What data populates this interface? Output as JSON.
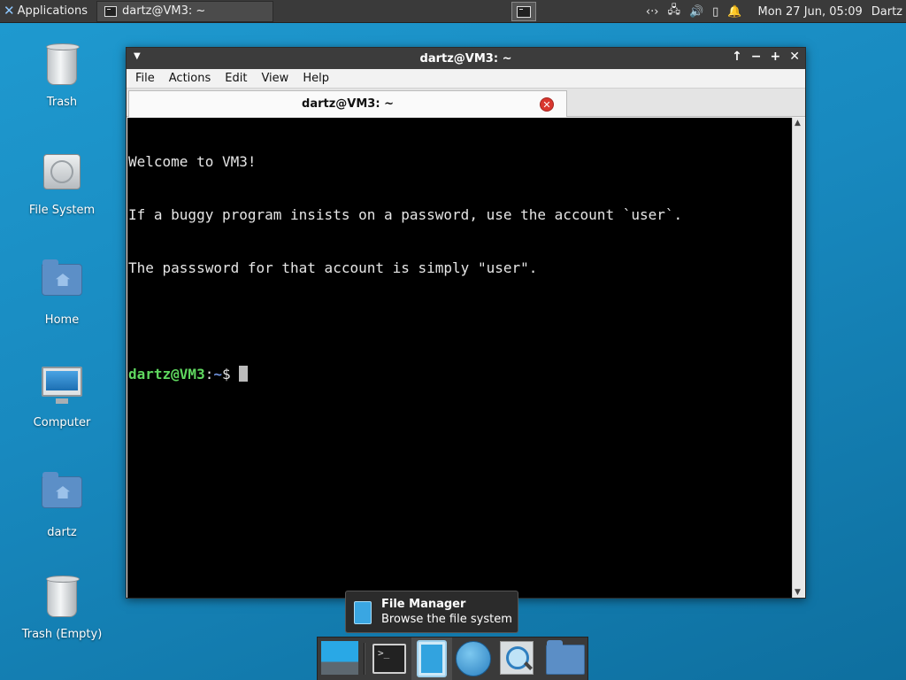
{
  "panel": {
    "applications_label": "Applications",
    "task_title": "dartz@VM3: ~",
    "clock": "Mon 27 Jun, 05:09",
    "user": "Dartz"
  },
  "desktop": {
    "icons": [
      {
        "label": "Trash",
        "icon": "trash-icon"
      },
      {
        "label": "File System",
        "icon": "hard-drive-icon"
      },
      {
        "label": "Home",
        "icon": "home-folder-icon"
      },
      {
        "label": "Computer",
        "icon": "computer-icon"
      },
      {
        "label": "dartz",
        "icon": "home-folder-icon"
      },
      {
        "label": "Trash (Empty)",
        "icon": "trash-icon"
      }
    ]
  },
  "window": {
    "title": "dartz@VM3: ~",
    "menu": [
      "File",
      "Actions",
      "Edit",
      "View",
      "Help"
    ],
    "tab_title": "dartz@VM3: ~"
  },
  "terminal": {
    "lines": [
      "Welcome to VM3!",
      "If a buggy program insists on a password, use the account `user`.",
      "The passsword for that account is simply \"user\"."
    ],
    "prompt_user": "dartz@VM3",
    "prompt_colon": ":",
    "prompt_path": "~",
    "prompt_symbol": "$"
  },
  "tooltip": {
    "title": "File Manager",
    "subtitle": "Browse the file system"
  },
  "colors": {
    "desktop_bg": "#1889bf",
    "panel_bg": "#3a3a3a",
    "prompt_user": "#5fd75f",
    "prompt_path": "#6d8fd8"
  }
}
